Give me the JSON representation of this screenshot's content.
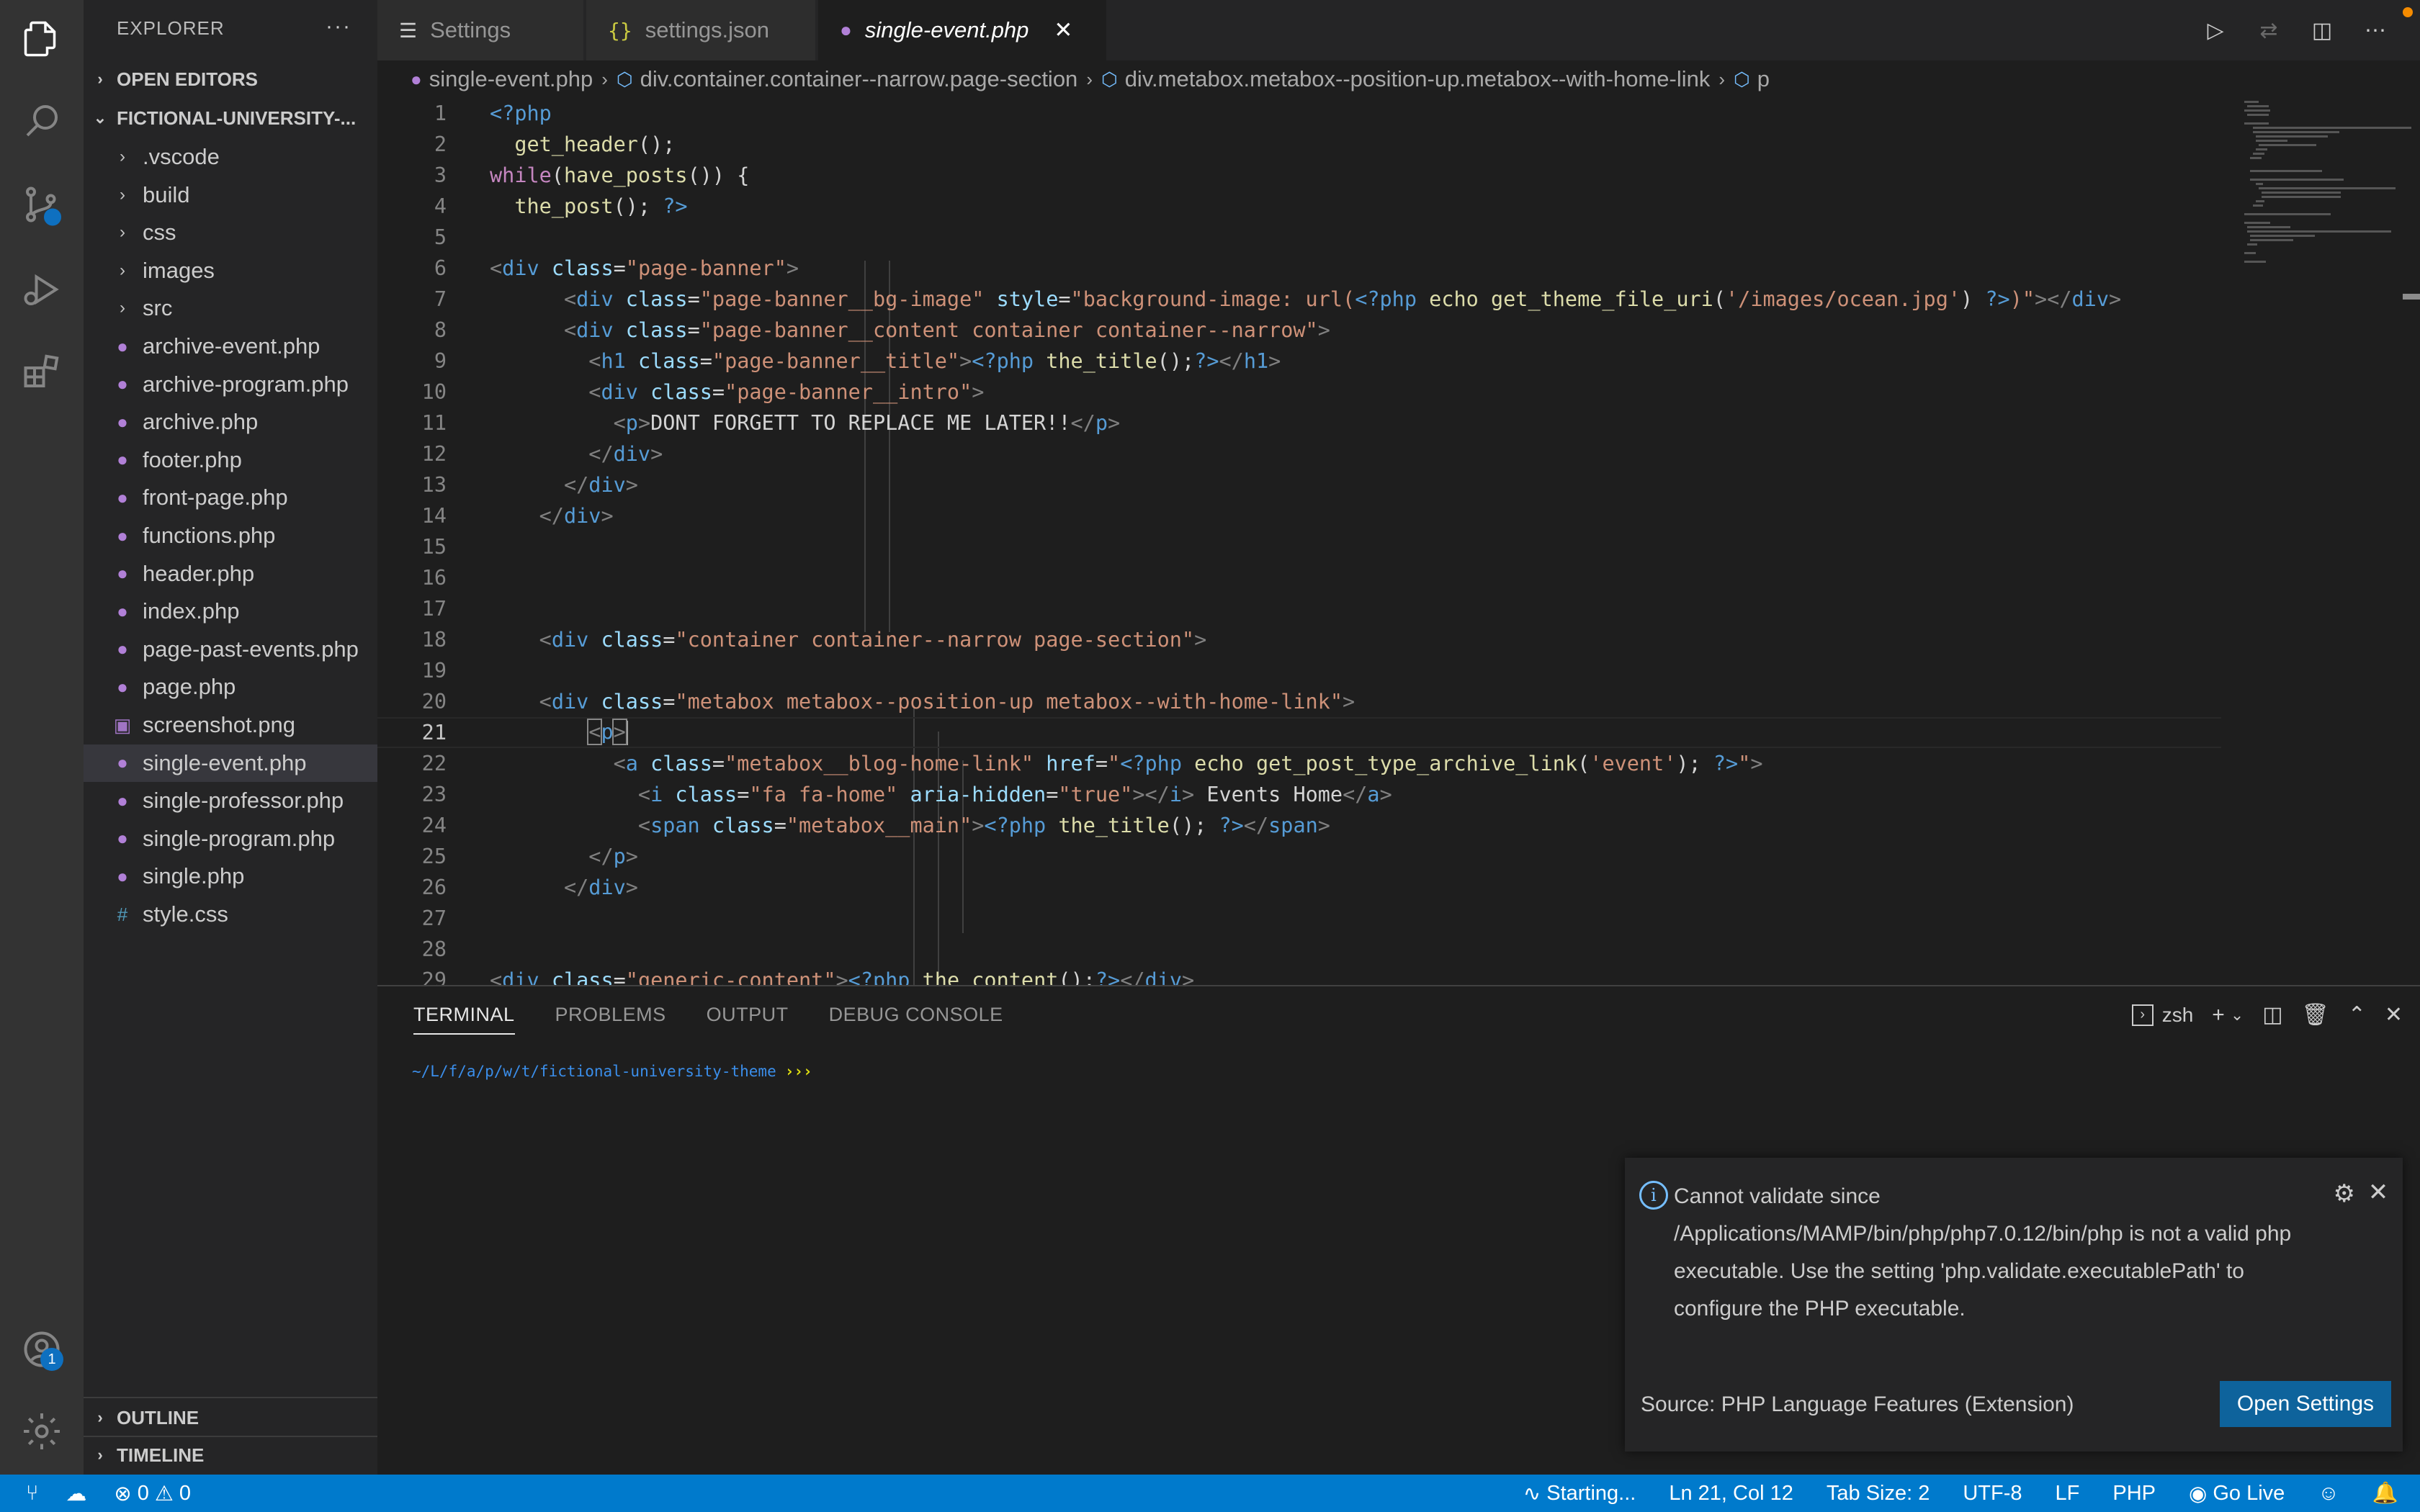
{
  "sidebar": {
    "title": "EXPLORER",
    "more": "···",
    "open_editors": "OPEN EDITORS",
    "root": "FICTIONAL-UNIVERSITY-...",
    "folders": [
      ".vscode",
      "build",
      "css",
      "images",
      "src"
    ],
    "files": [
      "archive-event.php",
      "archive-program.php",
      "archive.php",
      "footer.php",
      "front-page.php",
      "functions.php",
      "header.php",
      "index.php",
      "page-past-events.php",
      "page.php",
      "screenshot.png",
      "single-event.php",
      "single-professor.php",
      "single-program.php",
      "single.php",
      "style.css"
    ],
    "outline": "OUTLINE",
    "timeline": "TIMELINE"
  },
  "activity": {
    "accounts_badge": "1"
  },
  "tabs": [
    {
      "label": "Settings",
      "icon": "hamburger-icon"
    },
    {
      "label": "settings.json",
      "icon": "json-braces-icon"
    },
    {
      "label": "single-event.php",
      "icon": "php-elephant-icon",
      "active": true
    }
  ],
  "breadcrumb": [
    "single-event.php",
    "div.container.container--narrow.page-section",
    "div.metabox.metabox--position-up.metabox--with-home-link",
    "p"
  ],
  "editor": {
    "line_numbers": [
      "1",
      "2",
      "3",
      "4",
      "5",
      "6",
      "7",
      "8",
      "9",
      "10",
      "11",
      "12",
      "13",
      "14",
      "15",
      "16",
      "17",
      "18",
      "19",
      "20",
      "21",
      "22",
      "23",
      "24",
      "25",
      "26",
      "27",
      "28",
      "29"
    ],
    "current_line": 21
  },
  "panel": {
    "tabs": [
      "TERMINAL",
      "PROBLEMS",
      "OUTPUT",
      "DEBUG CONSOLE"
    ],
    "shell": "zsh",
    "prompt": "~/L/f/a/p/w/t/fictional-university-theme",
    "prompt_arrows": "›››"
  },
  "notification": {
    "message": "Cannot validate since /Applications/MAMP/bin/php/php7.0.12/bin/php is not a valid php executable. Use the setting 'php.validate.executablePath' to configure the PHP executable.",
    "source": "Source: PHP Language Features (Extension)",
    "button": "Open Settings"
  },
  "statusbar": {
    "errors": "0",
    "warnings": "0",
    "starting": "Starting...",
    "position": "Ln 21, Col 12",
    "tab_size": "Tab Size: 2",
    "encoding": "UTF-8",
    "eol": "LF",
    "language": "PHP",
    "go_live": "Go Live"
  },
  "colors": {
    "statusbar": "#007acc",
    "button": "#0e639c",
    "php_icon": "#b180d7",
    "css_icon": "#519aba"
  }
}
